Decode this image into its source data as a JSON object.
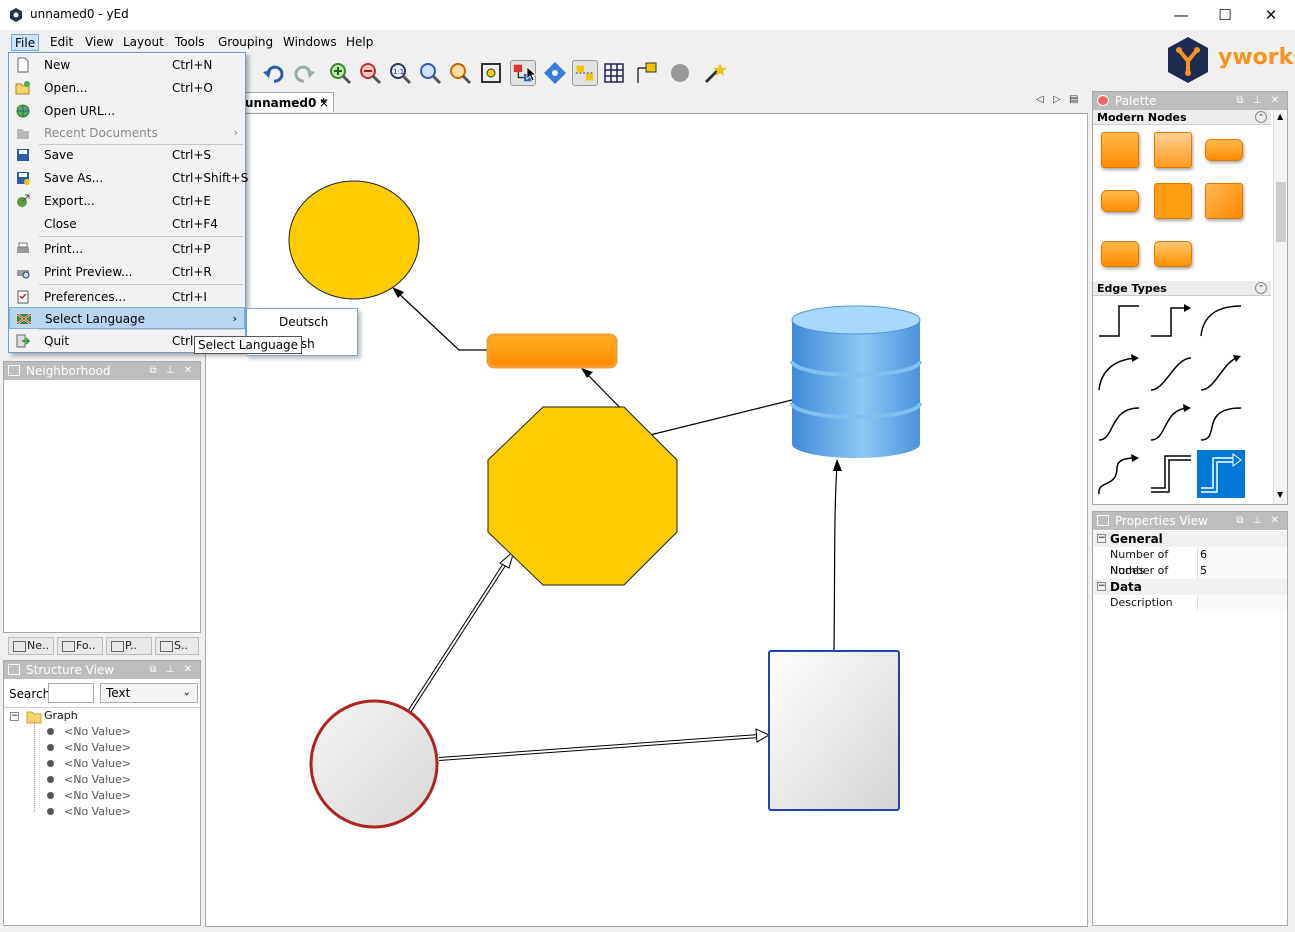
{
  "window": {
    "title": "unnamed0 - yEd",
    "minimize": "—",
    "maximize": "☐",
    "close": "✕"
  },
  "menubar": [
    "File",
    "Edit",
    "View",
    "Layout",
    "Tools",
    "Grouping",
    "Windows",
    "Help"
  ],
  "logo": {
    "text": "yworks"
  },
  "document_tab": {
    "label": "unnamed0 *",
    "close": "×"
  },
  "tab_nav": {
    "prev": "◁",
    "next": "▷",
    "list": "▤"
  },
  "file_menu": [
    {
      "label": "New",
      "accel": "Ctrl+N",
      "icon": "new-document-icon"
    },
    {
      "label": "Open...",
      "accel": "Ctrl+O",
      "icon": "open-folder-icon"
    },
    {
      "label": "Open URL...",
      "accel": "",
      "icon": "globe-icon"
    },
    {
      "label": "Recent Documents",
      "accel": "",
      "icon": "recent-icon",
      "disabled": true
    },
    {
      "label": "Save",
      "accel": "Ctrl+S",
      "icon": "floppy-icon"
    },
    {
      "label": "Save As...",
      "accel": "Ctrl+Shift+S",
      "icon": "floppy-as-icon"
    },
    {
      "label": "Export...",
      "accel": "Ctrl+E",
      "icon": "export-icon"
    },
    {
      "label": "Close",
      "accel": "Ctrl+F4",
      "icon": ""
    },
    {
      "label": "Print...",
      "accel": "Ctrl+P",
      "icon": "printer-icon"
    },
    {
      "label": "Print Preview...",
      "accel": "Ctrl+R",
      "icon": "print-preview-icon"
    },
    {
      "label": "Preferences...",
      "accel": "Ctrl+I",
      "icon": "preferences-icon"
    },
    {
      "label": "Select Language",
      "accel": "",
      "icon": "flag-icon",
      "submenu": true
    },
    {
      "label": "Quit",
      "accel": "Ctrl",
      "icon": "quit-icon"
    }
  ],
  "language_menu": [
    "Deutsch",
    "nglish"
  ],
  "tooltip": "Select Language",
  "neighborhood": {
    "title": "Neighborhood"
  },
  "bottom_tabs": [
    "Ne..",
    "Fo..",
    "P..",
    "S.."
  ],
  "structure_view": {
    "title": "Structure View",
    "search_label": "Search",
    "search_value": "",
    "search_type": "Text",
    "tree_root": "Graph",
    "tree_children": [
      "<No Value>",
      "<No Value>",
      "<No Value>",
      "<No Value>",
      "<No Value>",
      "<No Value>"
    ]
  },
  "palette": {
    "title": "Palette",
    "section_nodes": "Modern Nodes",
    "section_edges": "Edge Types"
  },
  "properties": {
    "title": "Properties View",
    "groups": [
      {
        "name": "General",
        "rows": [
          {
            "key": "Number of Nodes",
            "value": "6"
          },
          {
            "key": "Number of Edges",
            "value": "5"
          }
        ]
      },
      {
        "name": "Data",
        "rows": [
          {
            "key": "Description",
            "value": ""
          }
        ]
      }
    ]
  },
  "colors": {
    "accent": "#0078d7",
    "node_yellow": "#ffcc00",
    "node_orange": "#ff9900",
    "db_blue": "#5fa8e8",
    "circle_border": "#b22222"
  }
}
